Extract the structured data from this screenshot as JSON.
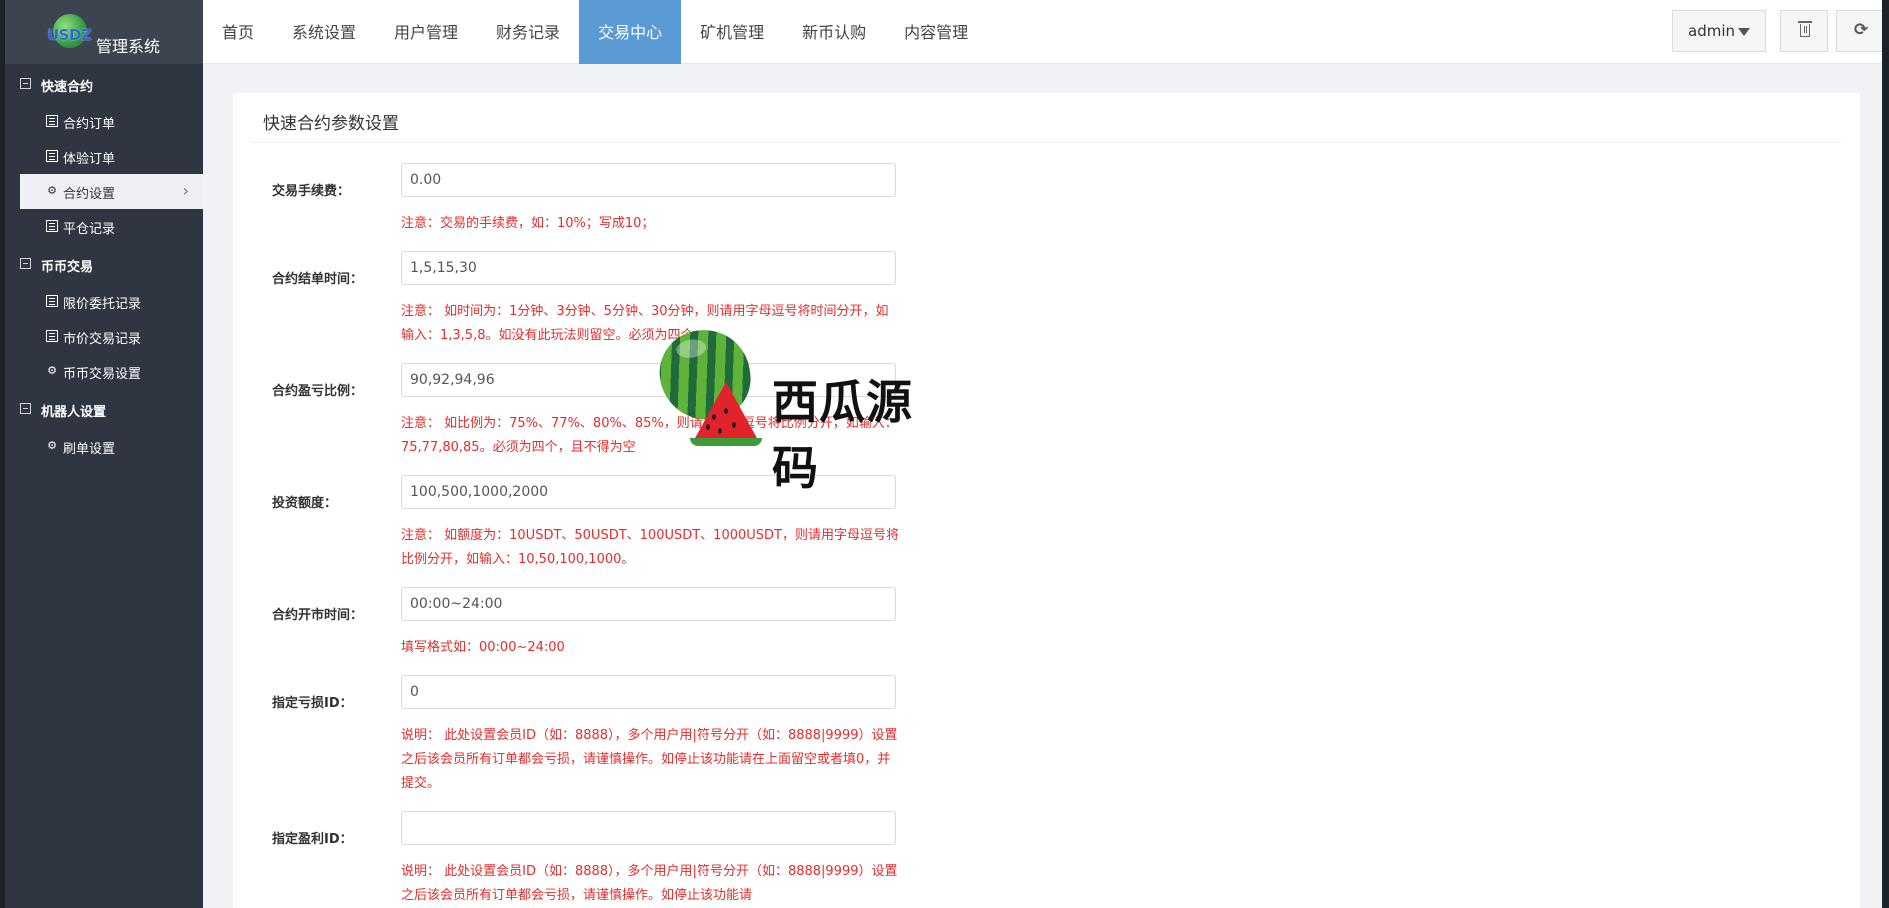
{
  "logo": {
    "brand": "USDZ",
    "text": "管理系统"
  },
  "sidebar": {
    "groups": [
      {
        "label": "快速合约",
        "items": [
          {
            "label": "合约订单",
            "icon": "list-icon"
          },
          {
            "label": "体验订单",
            "icon": "list-icon"
          },
          {
            "label": "合约设置",
            "icon": "gear-icon",
            "active": true
          },
          {
            "label": "平仓记录",
            "icon": "list-icon"
          }
        ]
      },
      {
        "label": "币币交易",
        "items": [
          {
            "label": "限价委托记录",
            "icon": "list-icon"
          },
          {
            "label": "市价交易记录",
            "icon": "list-icon"
          },
          {
            "label": "币币交易设置",
            "icon": "gear-icon"
          }
        ]
      },
      {
        "label": "机器人设置",
        "items": [
          {
            "label": "刷单设置",
            "icon": "gear-icon"
          }
        ]
      }
    ]
  },
  "topnav": {
    "items": [
      "首页",
      "系统设置",
      "用户管理",
      "财务记录",
      "交易中心",
      "矿机管理",
      "新币认购",
      "内容管理"
    ],
    "active": "交易中心",
    "admin_label": "admin"
  },
  "panel": {
    "title": "快速合约参数设置",
    "fields": [
      {
        "label": "交易手续费：",
        "value": "0.00",
        "note": "注意：交易的手续费，如：10%；写成10；"
      },
      {
        "label": "合约结单时间：",
        "value": "1,5,15,30",
        "note": "注意： 如时间为：1分钟、3分钟、5分钟、30分钟，则请用字母逗号将时间分开，如输入：1,3,5,8。如没有此玩法则留空。必须为四个"
      },
      {
        "label": "合约盈亏比例：",
        "value": "90,92,94,96",
        "note": "注意： 如比例为：75%、77%、80%、85%，则请用字母逗号将比例分开，如输入：75,77,80,85。必须为四个，且不得为空"
      },
      {
        "label": "投资额度：",
        "value": "100,500,1000,2000",
        "note": "注意： 如额度为：10USDT、50USDT、100USDT、1000USDT，则请用字母逗号将比例分开，如输入：10,50,100,1000。"
      },
      {
        "label": "合约开市时间：",
        "value": "00:00~24:00",
        "note": "填写格式如：00:00~24:00"
      },
      {
        "label": "指定亏损ID：",
        "value": "0",
        "note": "说明： 此处设置会员ID（如：8888），多个用户用|符号分开（如：8888|9999）设置之后该会员所有订单都会亏损，请谨慎操作。如停止该功能请在上面留空或者填0，并提交。"
      },
      {
        "label": "指定盈利ID：",
        "value": "",
        "note": "说明： 此处设置会员ID（如：8888），多个用户用|符号分开（如：8888|9999）设置之后该会员所有订单都会亏损，请谨慎操作。如停止该功能请"
      }
    ]
  },
  "watermark": {
    "text": "西瓜源码"
  }
}
